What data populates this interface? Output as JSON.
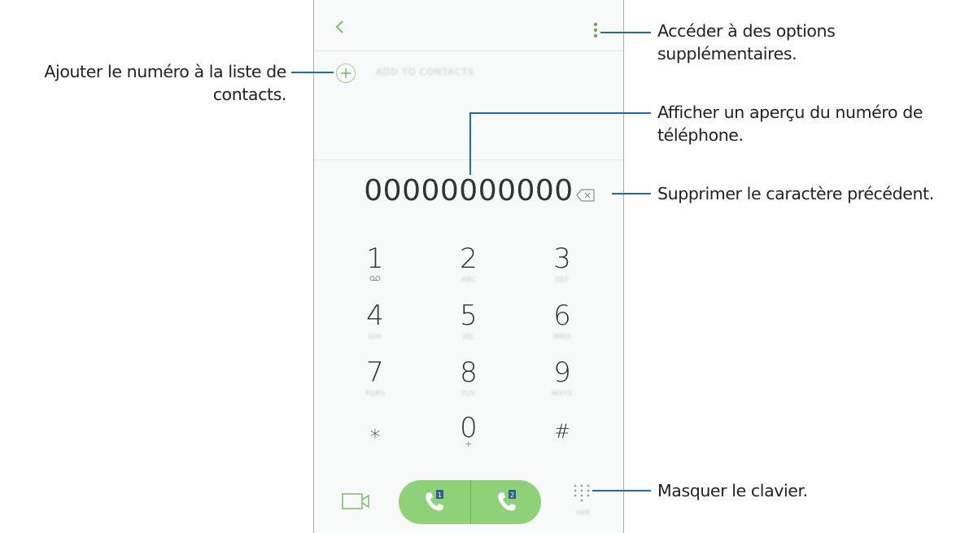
{
  "phone": {
    "add_to_contacts_label": "ADD TO CONTACTS",
    "phone_number": "00000000000",
    "keypad": [
      {
        "digit": "1",
        "letters": "∞"
      },
      {
        "digit": "2",
        "letters": "ABC"
      },
      {
        "digit": "3",
        "letters": "DEF"
      },
      {
        "digit": "4",
        "letters": "GHI"
      },
      {
        "digit": "5",
        "letters": "JKL"
      },
      {
        "digit": "6",
        "letters": "MNO"
      },
      {
        "digit": "7",
        "letters": "PQRS"
      },
      {
        "digit": "8",
        "letters": "TUV"
      },
      {
        "digit": "9",
        "letters": "WXYZ"
      },
      {
        "digit": "⁎",
        "letters": ""
      },
      {
        "digit": "0",
        "letters": "+"
      },
      {
        "digit": "#",
        "letters": ""
      }
    ],
    "sim1_label": "1",
    "sim2_label": "2",
    "hide_label": "HIDE",
    "accent_color": "#8fd179"
  },
  "annotations": {
    "options": [
      "Accéder à des options",
      "supplémentaires."
    ],
    "add_contact": [
      "Ajouter le numéro à la liste de",
      "contacts."
    ],
    "preview": [
      "Afficher un aperçu du numéro de",
      "téléphone."
    ],
    "delete": "Supprimer le caractère précédent.",
    "hide_keypad": "Masquer le clavier."
  }
}
